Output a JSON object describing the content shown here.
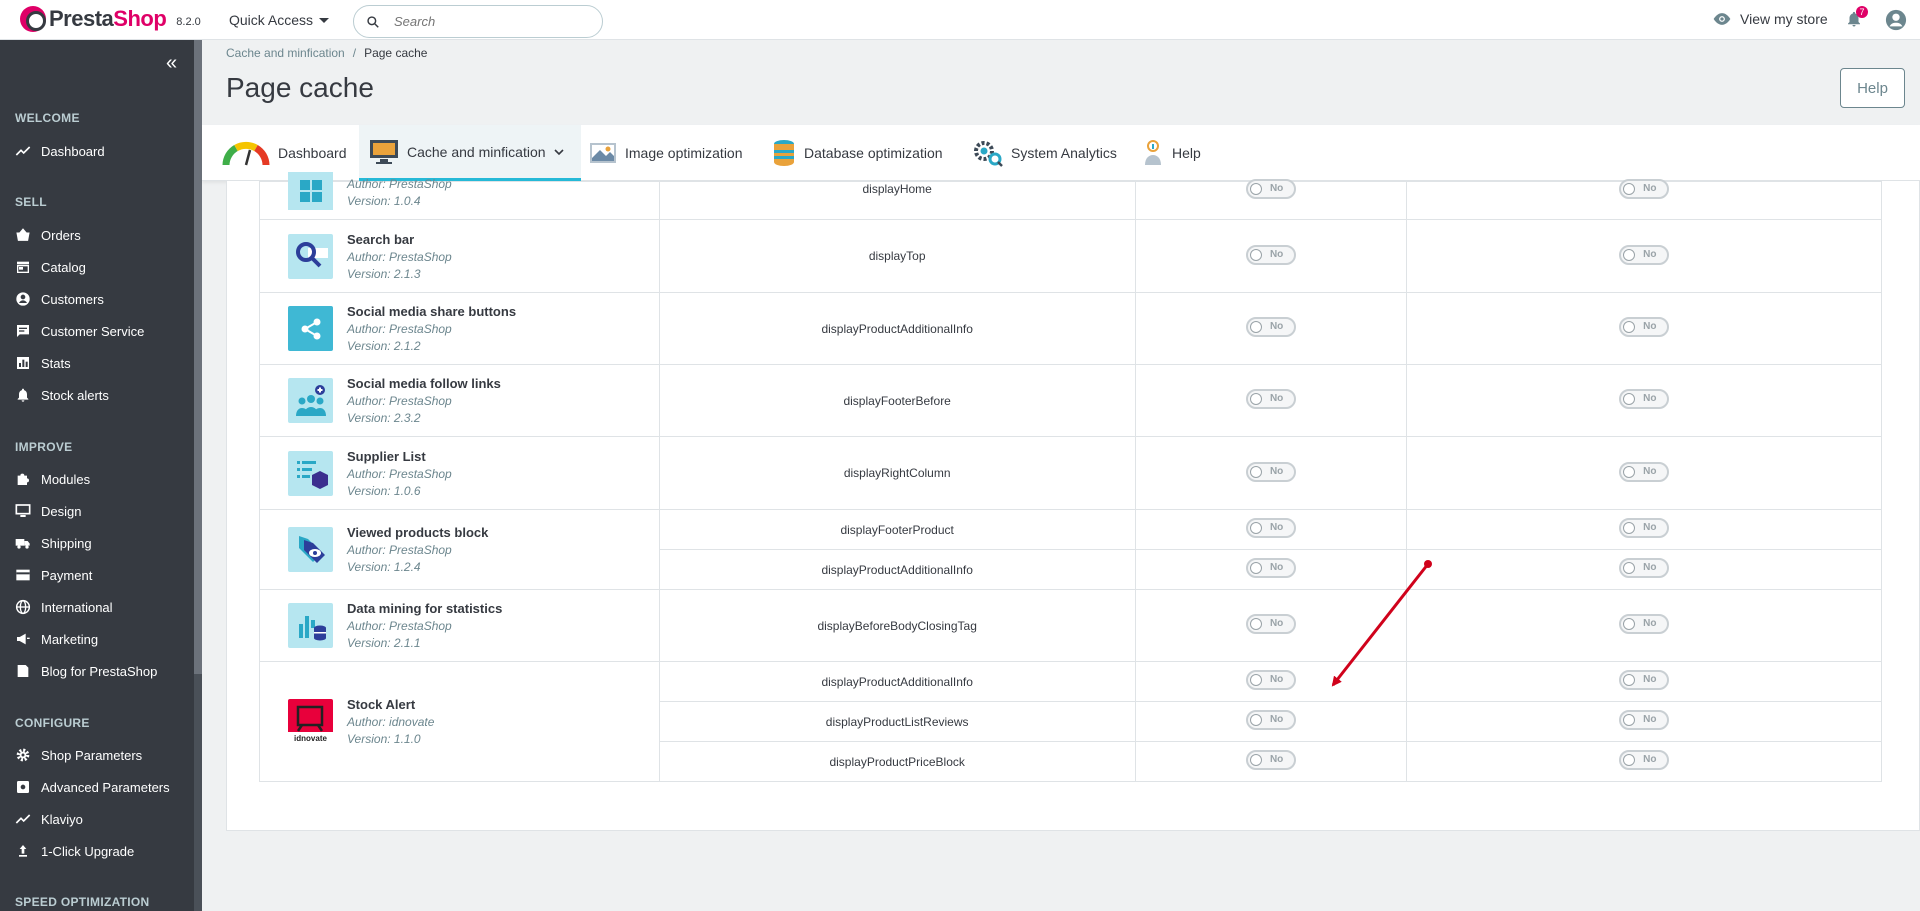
{
  "topbar": {
    "brand_part1": "Presta",
    "brand_part2": "Shop",
    "version": "8.2.0",
    "quick_access": "Quick Access",
    "search_placeholder": "Search",
    "view_store": "View my store",
    "notifications_count": "7"
  },
  "sidebar": {
    "sections": [
      {
        "title": "WELCOME",
        "items": [
          {
            "label": "Dashboard",
            "icon": "trending-up-icon"
          }
        ]
      },
      {
        "title": "SELL",
        "items": [
          {
            "label": "Orders",
            "icon": "shopping-basket-icon"
          },
          {
            "label": "Catalog",
            "icon": "store-icon"
          },
          {
            "label": "Customers",
            "icon": "account-circle-icon"
          },
          {
            "label": "Customer Service",
            "icon": "chat-icon"
          },
          {
            "label": "Stats",
            "icon": "bar-chart-icon"
          },
          {
            "label": "Stock alerts",
            "icon": "bell-alert-icon"
          }
        ]
      },
      {
        "title": "IMPROVE",
        "items": [
          {
            "label": "Modules",
            "icon": "puzzle-icon"
          },
          {
            "label": "Design",
            "icon": "desktop-icon"
          },
          {
            "label": "Shipping",
            "icon": "truck-icon"
          },
          {
            "label": "Payment",
            "icon": "credit-card-icon"
          },
          {
            "label": "International",
            "icon": "globe-icon"
          },
          {
            "label": "Marketing",
            "icon": "megaphone-icon"
          },
          {
            "label": "Blog for PrestaShop",
            "icon": "book-icon"
          }
        ]
      },
      {
        "title": "CONFIGURE",
        "items": [
          {
            "label": "Shop Parameters",
            "icon": "gear-icon"
          },
          {
            "label": "Advanced Parameters",
            "icon": "settings-applications-icon"
          },
          {
            "label": "Klaviyo",
            "icon": "trending-up-icon"
          },
          {
            "label": "1-Click Upgrade",
            "icon": "upload-icon"
          }
        ]
      },
      {
        "title": "SPEED OPTIMIZATION",
        "items": []
      }
    ]
  },
  "breadcrumb": {
    "parent": "Cache and minfication",
    "current": "Page cache"
  },
  "page_title": "Page cache",
  "help_label": "Help",
  "tabs": [
    {
      "label": "Dashboard",
      "icon": "gauge-icon"
    },
    {
      "label": "Cache and minfication",
      "icon": "monitor-icon",
      "active": true
    },
    {
      "label": "Image optimization",
      "icon": "image-icon"
    },
    {
      "label": "Database optimization",
      "icon": "database-icon"
    },
    {
      "label": "System Analytics",
      "icon": "analytics-gears-icon"
    },
    {
      "label": "Help",
      "icon": "help-person-icon"
    }
  ],
  "toggle_label": "No",
  "modules": [
    {
      "name": "",
      "author": "Author: PrestaShop",
      "version": "Version: 1.0.4",
      "icon": "grid-icon",
      "hooks": [
        "displayHome"
      ]
    },
    {
      "name": "Search bar",
      "author": "Author: PrestaShop",
      "version": "Version: 2.1.3",
      "icon": "magnifier-icon",
      "hooks": [
        "displayTop"
      ]
    },
    {
      "name": "Social media share buttons",
      "author": "Author: PrestaShop",
      "version": "Version: 2.1.2",
      "icon": "share-icon",
      "hooks": [
        "displayProductAdditionalInfo"
      ]
    },
    {
      "name": "Social media follow links",
      "author": "Author: PrestaShop",
      "version": "Version: 2.3.2",
      "icon": "people-icon",
      "hooks": [
        "displayFooterBefore"
      ]
    },
    {
      "name": "Supplier List",
      "author": "Author: PrestaShop",
      "version": "Version: 1.0.6",
      "icon": "supplier-list-icon",
      "hooks": [
        "displayRightColumn"
      ]
    },
    {
      "name": "Viewed products block",
      "author": "Author: PrestaShop",
      "version": "Version: 1.2.4",
      "icon": "tag-eye-icon",
      "hooks": [
        "displayFooterProduct",
        "displayProductAdditionalInfo"
      ]
    },
    {
      "name": "Data mining for statistics",
      "author": "Author: PrestaShop",
      "version": "Version: 2.1.1",
      "icon": "chart-database-icon",
      "hooks": [
        "displayBeforeBodyClosingTag"
      ]
    },
    {
      "name": "Stock Alert",
      "author": "Author: idnovate",
      "version": "Version: 1.1.0",
      "icon": "idnovate-logo-icon",
      "hooks": [
        "displayProductAdditionalInfo",
        "displayProductListReviews",
        "displayProductPriceBlock"
      ]
    }
  ],
  "colors": {
    "accent": "#25b9d7",
    "brand": "#df0067",
    "sidebar": "#363a41",
    "annotation_arrow": "#d0021b"
  }
}
